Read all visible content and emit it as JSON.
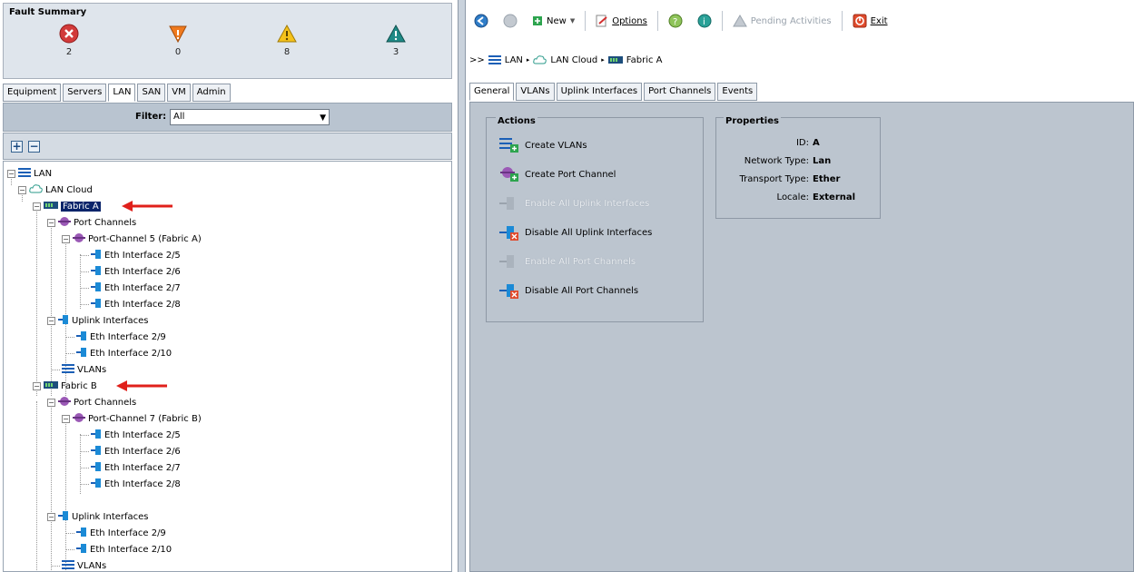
{
  "fault_summary": {
    "title": "Fault Summary",
    "items": [
      {
        "name": "critical",
        "count": "2",
        "color": "#d23a3a"
      },
      {
        "name": "major",
        "count": "0",
        "color": "#f07a1e"
      },
      {
        "name": "minor",
        "count": "8",
        "color": "#f5c21b"
      },
      {
        "name": "warning",
        "count": "3",
        "color": "#1f8a86"
      }
    ]
  },
  "left_tabs": [
    "Equipment",
    "Servers",
    "LAN",
    "SAN",
    "VM",
    "Admin"
  ],
  "left_active_tab": "LAN",
  "filter": {
    "label": "Filter:",
    "value": "All"
  },
  "tree": {
    "root": "LAN",
    "cloud": "LAN Cloud",
    "fabric_a": "Fabric A",
    "port_channels": "Port Channels",
    "pc5": "Port-Channel 5 (Fabric A)",
    "eth25": "Eth Interface 2/5",
    "eth26": "Eth Interface 2/6",
    "eth27": "Eth Interface 2/7",
    "eth28": "Eth Interface 2/8",
    "uplink": "Uplink Interfaces",
    "eth29": "Eth Interface 2/9",
    "eth210": "Eth Interface 2/10",
    "vlans": "VLANs",
    "fabric_b": "Fabric B",
    "pc7": "Port-Channel 7 (Fabric B)"
  },
  "toolbar": {
    "new": "New",
    "options": "Options",
    "pending": "Pending Activities",
    "exit": "Exit"
  },
  "breadcrumb": {
    "prefix": ">>",
    "lan": "LAN",
    "cloud": "LAN Cloud",
    "fabric": "Fabric A"
  },
  "right_tabs": [
    "General",
    "VLANs",
    "Uplink Interfaces",
    "Port Channels",
    "Events"
  ],
  "right_active_tab": "General",
  "actions": {
    "title": "Actions",
    "items": [
      {
        "label": "Create VLANs",
        "enabled": true
      },
      {
        "label": "Create Port Channel",
        "enabled": true
      },
      {
        "label": "Enable All Uplink Interfaces",
        "enabled": false
      },
      {
        "label": "Disable All Uplink Interfaces",
        "enabled": true
      },
      {
        "label": "Enable All Port Channels",
        "enabled": false
      },
      {
        "label": "Disable All Port Channels",
        "enabled": true
      }
    ]
  },
  "properties": {
    "title": "Properties",
    "id_k": "ID:",
    "id_v": "A",
    "nt_k": "Network Type:",
    "nt_v": "Lan",
    "tt_k": "Transport Type:",
    "tt_v": "Ether",
    "lc_k": "Locale:",
    "lc_v": "External"
  },
  "colors": {
    "accent": "#0a246a",
    "arrow": "#e0201b",
    "panel": "#bcc5cf"
  }
}
